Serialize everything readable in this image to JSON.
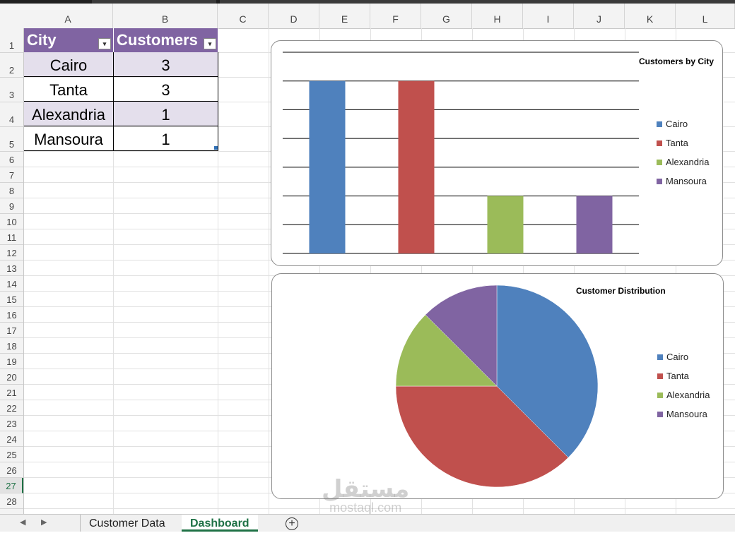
{
  "columns": [
    "A",
    "B",
    "C",
    "D",
    "E",
    "F",
    "G",
    "H",
    "I",
    "J",
    "K",
    "L"
  ],
  "rows": [
    1,
    2,
    3,
    4,
    5,
    6,
    7,
    8,
    9,
    10,
    11,
    12,
    13,
    14,
    15,
    16,
    17,
    18,
    19,
    20,
    21,
    22,
    23,
    24,
    25,
    26,
    27,
    28
  ],
  "selected_row": 27,
  "table": {
    "headers": [
      "City",
      "Customers"
    ],
    "rows": [
      {
        "city": "Cairo",
        "customers": "3"
      },
      {
        "city": "Tanta",
        "customers": "3"
      },
      {
        "city": "Alexandria",
        "customers": "1"
      },
      {
        "city": "Mansoura",
        "customers": "1"
      }
    ],
    "header_color": "#8064a2",
    "band_color": "#e4dfec"
  },
  "chart_data": [
    {
      "type": "bar",
      "title": "Customers by City",
      "categories": [
        "Cairo",
        "Tanta",
        "Alexandria",
        "Mansoura"
      ],
      "values": [
        3,
        3,
        1,
        1
      ],
      "colors": [
        "#4f81bd",
        "#c0504d",
        "#9bbb59",
        "#8064a2"
      ],
      "ylim": [
        0,
        3.5
      ],
      "grid": true,
      "legend": "right"
    },
    {
      "type": "pie",
      "title": "Customer Distribution",
      "categories": [
        "Cairo",
        "Tanta",
        "Alexandria",
        "Mansoura"
      ],
      "values": [
        3,
        3,
        1,
        1
      ],
      "colors": [
        "#4f81bd",
        "#c0504d",
        "#9bbb59",
        "#8064a2"
      ],
      "legend": "right"
    }
  ],
  "sheets": {
    "tabs": [
      "Customer Data",
      "Dashboard"
    ],
    "active": "Dashboard",
    "add_label": "+"
  },
  "watermark": {
    "arabic": "مستقل",
    "latin": "mostaql.com"
  }
}
